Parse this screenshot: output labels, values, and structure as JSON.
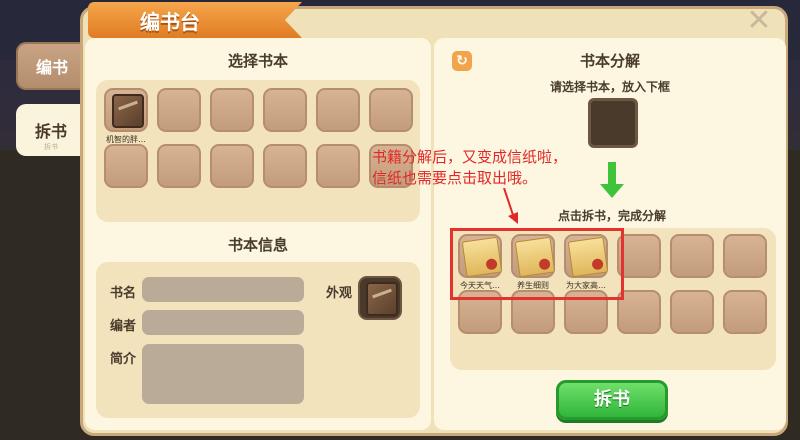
{
  "tabs": {
    "edit_label": "编书",
    "split_label": "拆书",
    "split_sub": "拆书"
  },
  "panel": {
    "title": "编书台",
    "close_glyph": "✕"
  },
  "select_book": {
    "title": "选择书本",
    "slots": [
      {
        "label": "机智的胖…",
        "item": "book"
      },
      {
        "label": "",
        "item": ""
      },
      {
        "label": "",
        "item": ""
      },
      {
        "label": "",
        "item": ""
      },
      {
        "label": "",
        "item": ""
      },
      {
        "label": "",
        "item": ""
      },
      {
        "label": "",
        "item": ""
      },
      {
        "label": "",
        "item": ""
      },
      {
        "label": "",
        "item": ""
      },
      {
        "label": "",
        "item": ""
      },
      {
        "label": "",
        "item": ""
      },
      {
        "label": "",
        "item": ""
      }
    ]
  },
  "book_info": {
    "title": "书本信息",
    "name_label": "书名",
    "author_label": "编者",
    "intro_label": "简介",
    "appearance_label": "外观"
  },
  "decompose": {
    "title": "书本分解",
    "instruction": "请选择书本，放入下框",
    "action_hint": "点击拆书，完成分解",
    "output_slots": [
      {
        "label": "今天天气…",
        "item": "paper"
      },
      {
        "label": "养生细则",
        "item": "paper"
      },
      {
        "label": "为大家高…",
        "item": "paper"
      },
      {
        "label": "",
        "item": ""
      },
      {
        "label": "",
        "item": ""
      },
      {
        "label": "",
        "item": ""
      },
      {
        "label": "",
        "item": ""
      },
      {
        "label": "",
        "item": ""
      },
      {
        "label": "",
        "item": ""
      },
      {
        "label": "",
        "item": ""
      },
      {
        "label": "",
        "item": ""
      },
      {
        "label": "",
        "item": ""
      }
    ],
    "split_button": "拆书"
  },
  "annotation": {
    "line1": "书籍分解后，又变成信纸啦，",
    "line2": "信纸也需要点击取出哦。"
  },
  "colors": {
    "accent_orange": "#e07c23",
    "button_green": "#31b53a",
    "annotation_red": "#e02828"
  },
  "icons": [
    "refresh-icon",
    "close-icon",
    "book-icon",
    "paper-icon",
    "arrow-down-icon"
  ]
}
